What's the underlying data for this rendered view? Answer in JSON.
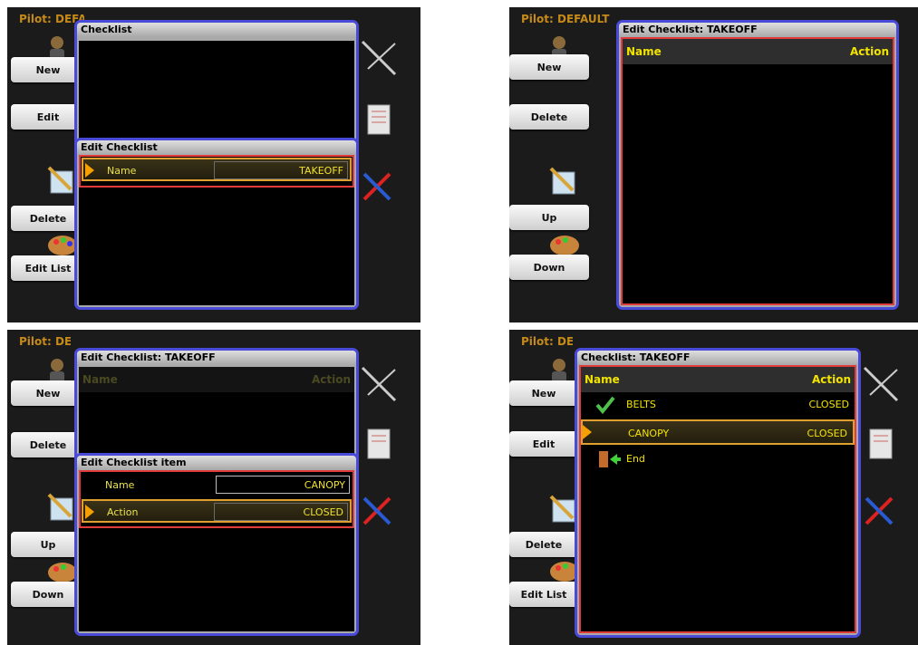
{
  "pilot": "Pilot: DEFAULT",
  "p1": {
    "buttons": [
      "New",
      "Edit",
      "Delete",
      "Edit List"
    ],
    "outer_title": "Checklist",
    "inner_title": "Edit Checklist",
    "field_label": "Name",
    "field_value": "TAKEOFF"
  },
  "p2": {
    "buttons": [
      "New",
      "Delete",
      "Up",
      "Down"
    ],
    "title": "Edit Checklist: TAKEOFF",
    "col_name": "Name",
    "col_action": "Action"
  },
  "p3": {
    "buttons": [
      "New",
      "Delete",
      "Up",
      "Down"
    ],
    "outer_title": "Edit Checklist: TAKEOFF",
    "col_name": "Name",
    "col_action": "Action",
    "inner_title": "Edit Checklist item",
    "name_label": "Name",
    "name_value": "CANOPY",
    "action_label": "Action",
    "action_value": "CLOSED"
  },
  "p4": {
    "buttons": [
      "New",
      "Edit",
      "Delete",
      "Edit List"
    ],
    "title": "Checklist: TAKEOFF",
    "col_name": "Name",
    "col_action": "Action",
    "items": [
      {
        "name": "BELTS",
        "action": "CLOSED",
        "icon": "checkmark-icon"
      },
      {
        "name": "CANOPY",
        "action": "CLOSED",
        "icon": "none"
      },
      {
        "name": "End",
        "action": "",
        "icon": "exit-door-icon"
      }
    ]
  },
  "colors": {
    "accent_yellow": "#f3e400",
    "frame_blue": "#4a4ad8",
    "focus_red": "#e23b3b",
    "selection_orange": "#e0a030"
  }
}
